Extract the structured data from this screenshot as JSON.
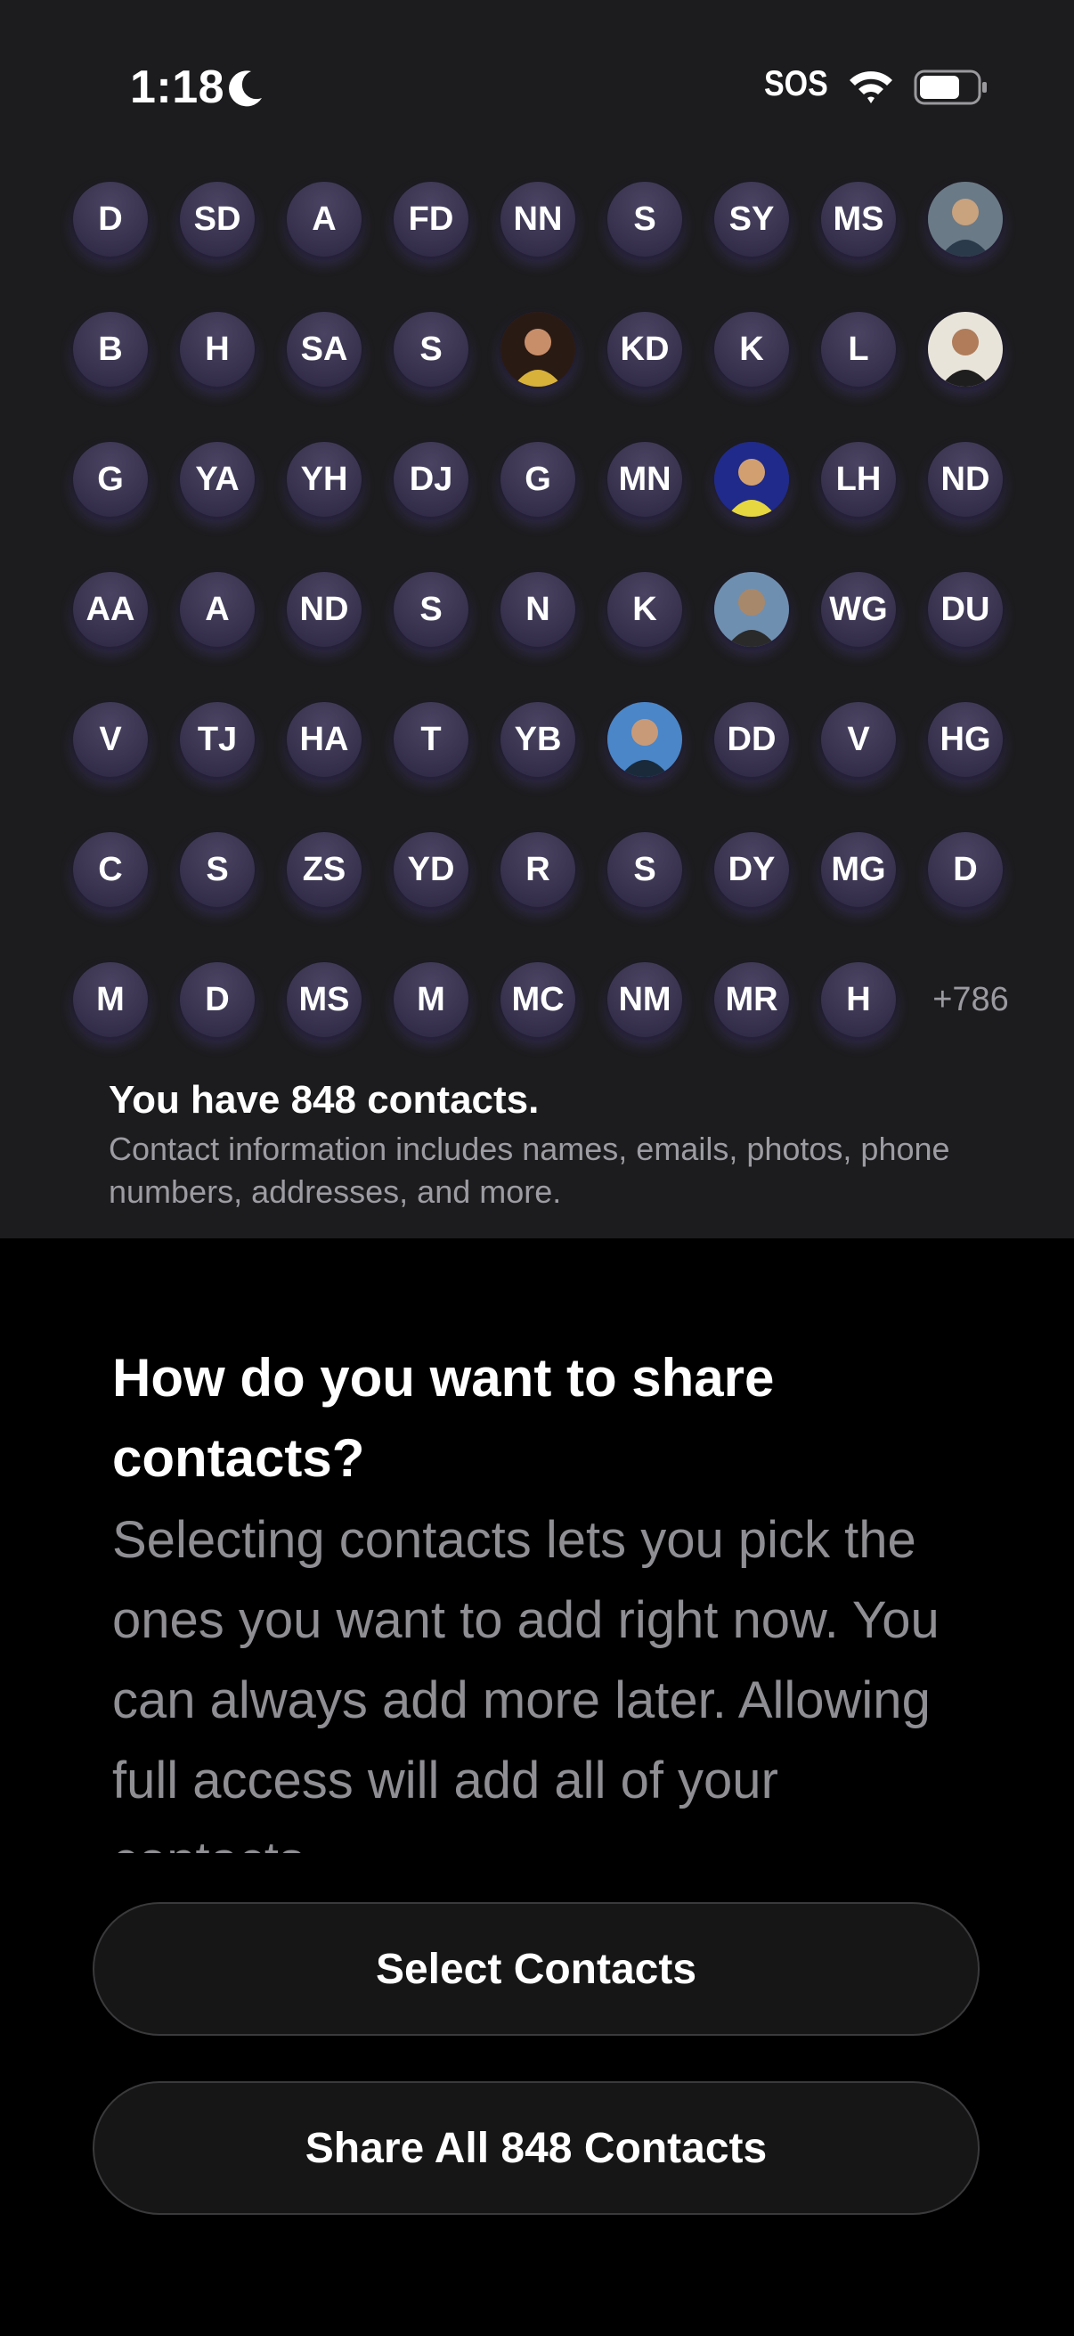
{
  "status_bar": {
    "time": "1:18",
    "sos": "SOS",
    "icons": [
      "moon-icon",
      "wifi-icon",
      "battery-icon"
    ]
  },
  "contact_grid": {
    "rows": [
      [
        "D",
        "SD",
        "A",
        "FD",
        "NN",
        "S",
        "SY",
        "MS",
        "photo"
      ],
      [
        "B",
        "H",
        "SA",
        "S",
        "photo",
        "KD",
        "K",
        "L",
        "photo"
      ],
      [
        "G",
        "YA",
        "YH",
        "DJ",
        "G",
        "MN",
        "photo",
        "LH",
        "ND"
      ],
      [
        "AA",
        "A",
        "ND",
        "S",
        "N",
        "K",
        "photo",
        "WG",
        "DU"
      ],
      [
        "V",
        "TJ",
        "HA",
        "T",
        "YB",
        "photo",
        "DD",
        "V",
        "HG"
      ],
      [
        "C",
        "S",
        "ZS",
        "YD",
        "R",
        "S",
        "DY",
        "MG",
        "D"
      ],
      [
        "M",
        "D",
        "MS",
        "M",
        "MC",
        "NM",
        "MR",
        "H",
        "more"
      ]
    ],
    "more_count": "+786"
  },
  "summary": {
    "count_text": "You have 848 contacts.",
    "info_text": "Contact information includes names, emails, photos, phone numbers, addresses, and more."
  },
  "prompt": {
    "question": "How do you want to share contacts?",
    "explanation": "Selecting contacts lets you pick the ones you want to add right now. You can always add more later. Allowing full access will add all of your contacts."
  },
  "buttons": {
    "select_label": "Select Contacts",
    "share_all_label": "Share All 848 Contacts"
  },
  "colors": {
    "panel_bg": "#1c1c1e",
    "sheet_bg": "#000000",
    "bubble": "#3a3450",
    "bubble_glow": "#8c6eff",
    "secondary_text": "#8e8e93"
  }
}
